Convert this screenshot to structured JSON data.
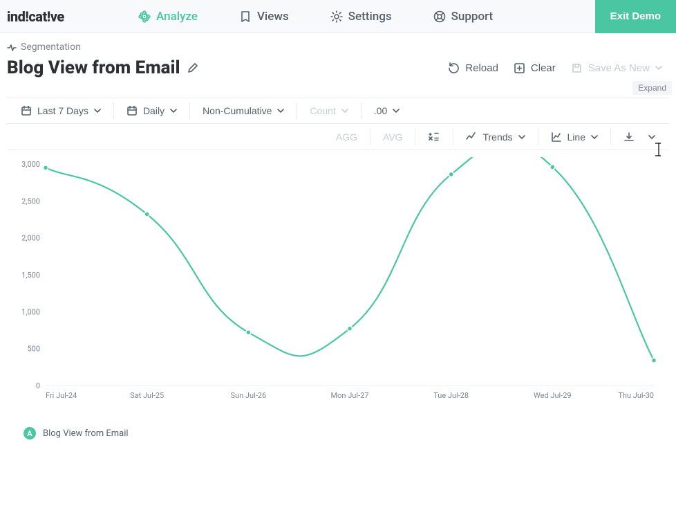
{
  "brand": "indicative",
  "nav": {
    "analyze": "Analyze",
    "views": "Views",
    "settings": "Settings",
    "support": "Support",
    "exit": "Exit Demo"
  },
  "breadcrumb": "Segmentation",
  "title": "Blog View from Email",
  "actions": {
    "reload": "Reload",
    "clear": "Clear",
    "save": "Save As New",
    "expand": "Expand"
  },
  "toolbar": {
    "range": "Last 7 Days",
    "granularity": "Daily",
    "accum": "Non-Cumulative",
    "metric": "Count",
    "decimals": ".00",
    "agg": "AGG",
    "avg": "AVG",
    "trends": "Trends",
    "charttype": "Line"
  },
  "legend": {
    "badge": "A",
    "label": "Blog View from Email"
  },
  "chart_data": {
    "type": "line",
    "title": "",
    "xlabel": "",
    "ylabel": "",
    "ylim": [
      0,
      3000
    ],
    "yticks": [
      0,
      500,
      1000,
      1500,
      2000,
      2500,
      3000
    ],
    "categories": [
      "Fri Jul-24",
      "Sat Jul-25",
      "Sun Jul-26",
      "Mon Jul-27",
      "Tue Jul-28",
      "Wed Jul-29",
      "Thu Jul-30"
    ],
    "series": [
      {
        "name": "Blog View from Email",
        "color": "#4bc6a3",
        "values": [
          2950,
          2320,
          720,
          770,
          2860,
          2960,
          340
        ]
      }
    ]
  }
}
